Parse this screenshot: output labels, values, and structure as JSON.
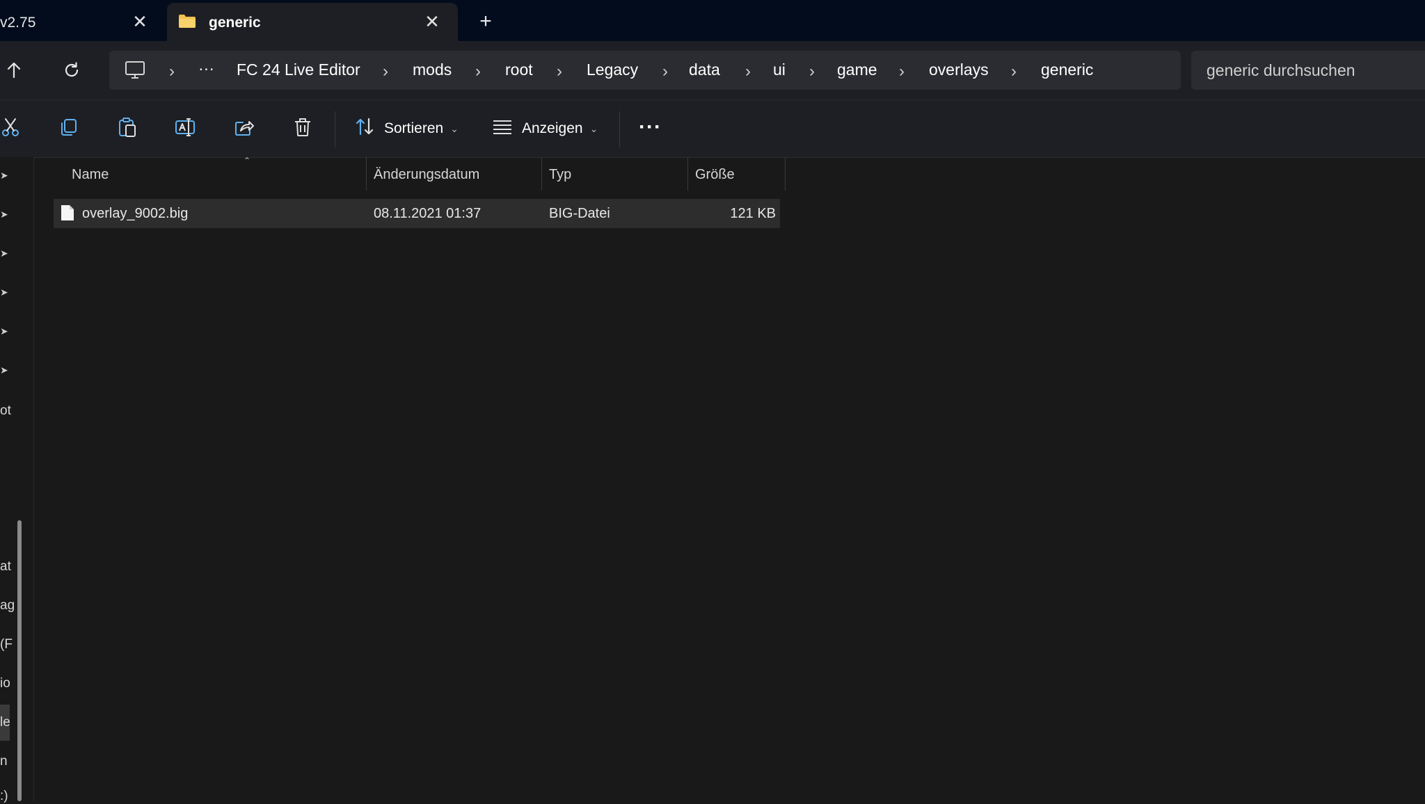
{
  "tabs": [
    {
      "title": "v2.75",
      "active": false
    },
    {
      "title": "generic",
      "active": true
    }
  ],
  "tab_close_glyph": "✕",
  "new_tab_glyph": "+",
  "breadcrumb": {
    "overflow": "···",
    "items": [
      "FC 24 Live Editor",
      "mods",
      "root",
      "Legacy",
      "data",
      "ui",
      "game",
      "overlays",
      "generic"
    ],
    "separator": "›"
  },
  "search": {
    "placeholder": "generic durchsuchen"
  },
  "commandbar": {
    "sort_label": "Sortieren",
    "view_label": "Anzeigen",
    "more_label": "···"
  },
  "leftpane": {
    "fragments": [
      "ot",
      "at",
      "ag",
      "(F",
      "io",
      "le",
      "n",
      ":)"
    ]
  },
  "columns": {
    "name": "Name",
    "modified": "Änderungsdatum",
    "type": "Typ",
    "size": "Größe"
  },
  "files": [
    {
      "name": "overlay_9002.big",
      "modified": "08.11.2021 01:37",
      "type": "BIG-Datei",
      "size": "121 KB"
    }
  ],
  "colors": {
    "titlebar": "#020c1d",
    "chrome": "#1d1f24",
    "content": "#191919",
    "selected_row": "#2d2d2d",
    "folder": "#f2c14e"
  }
}
